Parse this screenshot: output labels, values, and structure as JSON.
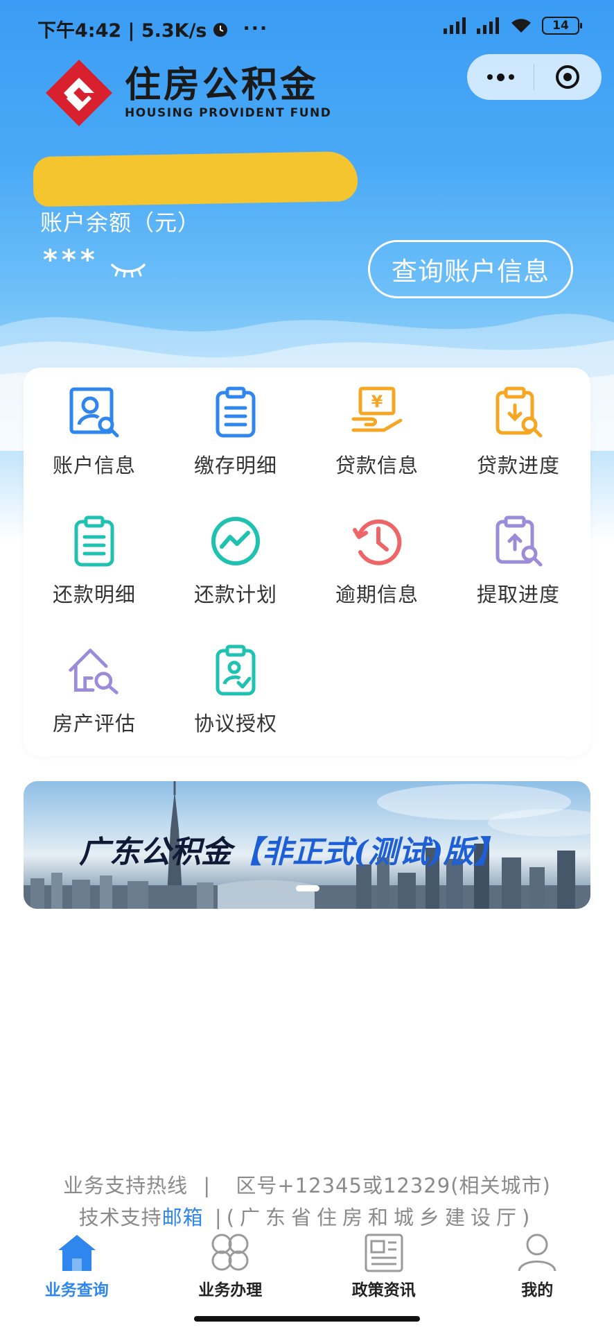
{
  "status_bar": {
    "time_speed": "下午4:42 | 5.3K/s",
    "more": "···",
    "battery": "14"
  },
  "logo": {
    "title_cn": "住房公积金",
    "title_en": "HOUSING PROVIDENT FUND"
  },
  "account": {
    "balance_label": "账户余额（元）",
    "balance_value": "***",
    "query_button": "查询账户信息"
  },
  "services": [
    {
      "label": "账户信息",
      "icon": "account-search-icon",
      "color": "#2f86ec"
    },
    {
      "label": "缴存明细",
      "icon": "clipboard-list-icon",
      "color": "#2f86ec"
    },
    {
      "label": "贷款信息",
      "icon": "yen-hand-icon",
      "color": "#f5a623"
    },
    {
      "label": "贷款进度",
      "icon": "clipboard-search-icon",
      "color": "#f5a623"
    },
    {
      "label": "还款明细",
      "icon": "clipboard-list-icon",
      "color": "#1fc1b0"
    },
    {
      "label": "还款计划",
      "icon": "trend-circle-icon",
      "color": "#1fc1b0"
    },
    {
      "label": "逾期信息",
      "icon": "clock-history-icon",
      "color": "#ef6466"
    },
    {
      "label": "提取进度",
      "icon": "clipboard-upload-icon",
      "color": "#9a8cd9"
    },
    {
      "label": "房产评估",
      "icon": "house-search-icon",
      "color": "#9a8cd9"
    },
    {
      "label": "协议授权",
      "icon": "clipboard-user-icon",
      "color": "#1fc1b0"
    }
  ],
  "banner": {
    "title_main": "广东公积金",
    "title_accent": "【非正式(测试)版】"
  },
  "footer": {
    "hotline_label": "业务支持热线",
    "separator": "|",
    "hotline_value": "区号+12345或12329(相关城市)",
    "tech_label": "技术支持",
    "email_link": "邮箱",
    "tech_org": "(广东省住房和城乡建设厅)"
  },
  "tabs": [
    {
      "label": "业务查询",
      "icon": "home-icon",
      "active": true
    },
    {
      "label": "业务办理",
      "icon": "grid-circles-icon",
      "active": false
    },
    {
      "label": "政策资讯",
      "icon": "news-icon",
      "active": false
    },
    {
      "label": "我的",
      "icon": "user-icon",
      "active": false
    }
  ],
  "colors": {
    "primary": "#2f86ec",
    "header_blue": "#3a9cf4",
    "redaction": "#f5c52f"
  }
}
